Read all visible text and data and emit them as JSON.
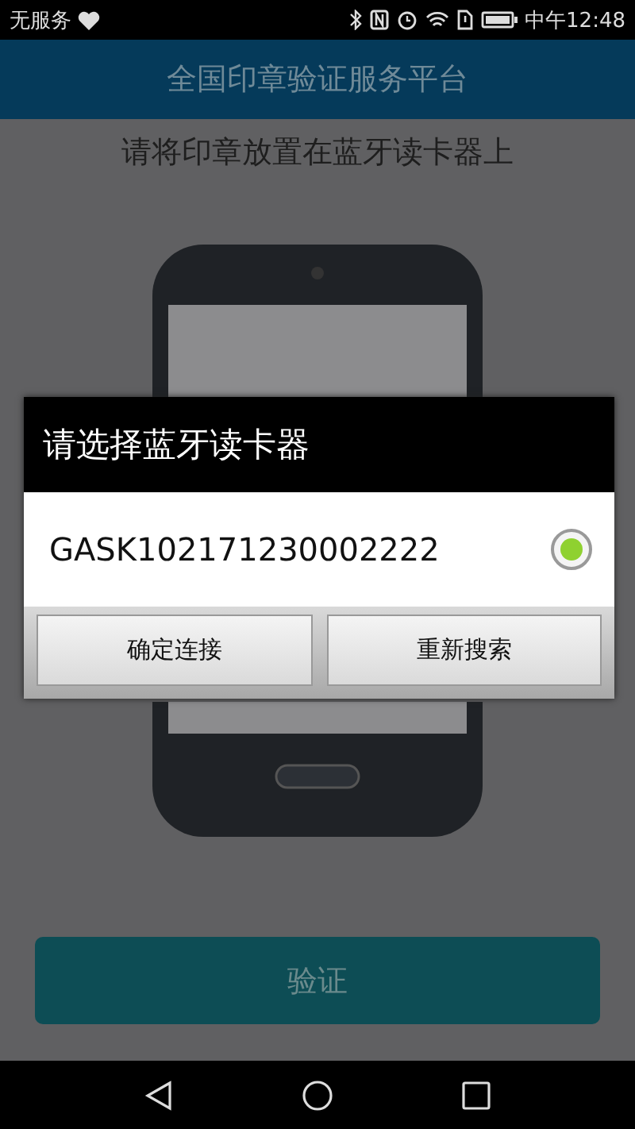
{
  "status_bar": {
    "carrier": "无服务",
    "time": "中午12:48"
  },
  "header": {
    "title": "全国印章验证服务平台"
  },
  "instruction": "请将印章放置在蓝牙读卡器上",
  "dialog": {
    "title": "请选择蓝牙读卡器",
    "devices": [
      {
        "name": "GASK102171230002222",
        "selected": true
      }
    ],
    "buttons": [
      "确定连接",
      "重新搜索"
    ]
  },
  "verify_button": "验证"
}
